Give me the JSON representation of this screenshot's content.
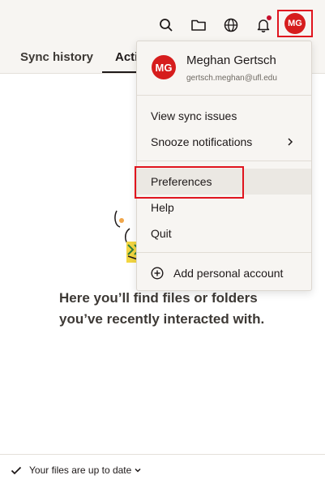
{
  "toolbar": {
    "avatar_initials": "MG",
    "notification_dot_color": "#c8102e",
    "accent_color": "#d61d1d"
  },
  "tabs": [
    {
      "label": "Sync history"
    },
    {
      "label": "Acti"
    }
  ],
  "empty_state": {
    "text": "Here you’ll find files or folders you’ve recently interacted with."
  },
  "footer": {
    "status": "Your files are up to date"
  },
  "menu": {
    "user": {
      "initials": "MG",
      "name": "Meghan Gertsch",
      "email": "gertsch.meghan@ufl.edu"
    },
    "items": {
      "view_sync_issues": "View sync issues",
      "snooze": "Snooze notifications",
      "preferences": "Preferences",
      "help": "Help",
      "quit": "Quit",
      "add_account": "Add personal account"
    }
  }
}
